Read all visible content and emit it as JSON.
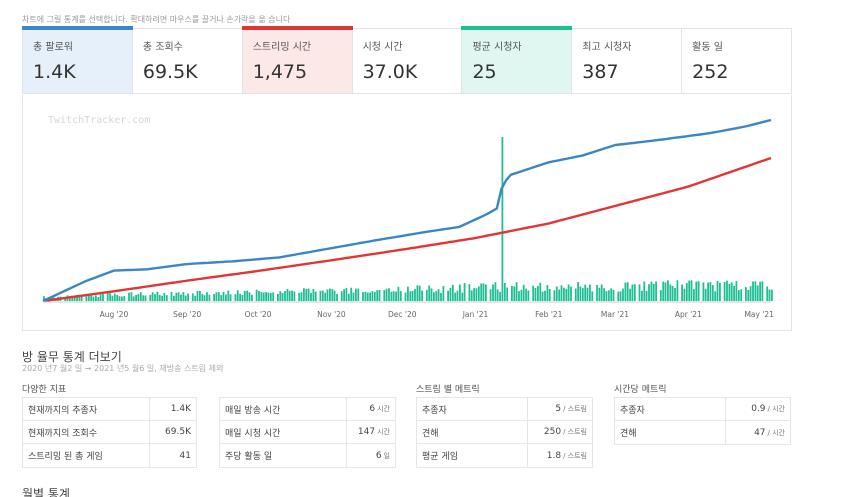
{
  "hint": "차트에 그릴 통계를 선택합니다. 확대하려면 마우스를 끌거나 손가락을 옮 습니다",
  "stats": [
    {
      "label": "총 팔로워",
      "value": "1.4K",
      "color": "blue"
    },
    {
      "label": "총 조회수",
      "value": "69.5K",
      "color": ""
    },
    {
      "label": "스트리밍 시간",
      "value": "1,475",
      "color": "red"
    },
    {
      "label": "시청 시간",
      "value": "37.0K",
      "color": ""
    },
    {
      "label": "평균 시청자",
      "value": "25",
      "color": "teal"
    },
    {
      "label": "최고 시청자",
      "value": "387",
      "color": ""
    },
    {
      "label": "활동 일",
      "value": "252",
      "color": ""
    }
  ],
  "chart": {
    "watermark": "TwitchTracker.com",
    "colors": {
      "followers": "#3b86c4",
      "hours": "#e23535",
      "viewers": "#1fbf93"
    }
  },
  "chart_data": {
    "type": "line",
    "x_ticks": [
      "Aug '20",
      "Sep '20",
      "Oct '20",
      "Nov '20",
      "Dec '20",
      "Jan '21",
      "Feb '21",
      "Mar '21",
      "Apr '21",
      "May '21"
    ],
    "x_range": [
      "2020-07-02",
      "2021-05-06"
    ],
    "series": [
      {
        "metric": "followers",
        "style": "line",
        "points": [
          [
            "2020-07-02",
            0
          ],
          [
            "2020-07-20",
            150
          ],
          [
            "2020-08-01",
            230
          ],
          [
            "2020-08-15",
            240
          ],
          [
            "2020-09-01",
            280
          ],
          [
            "2020-09-20",
            300
          ],
          [
            "2020-10-10",
            330
          ],
          [
            "2020-11-01",
            400
          ],
          [
            "2020-11-20",
            460
          ],
          [
            "2020-12-10",
            520
          ],
          [
            "2020-12-25",
            560
          ],
          [
            "2021-01-05",
            650
          ],
          [
            "2021-01-10",
            700
          ],
          [
            "2021-01-12",
            850
          ],
          [
            "2021-01-15",
            950
          ],
          [
            "2021-02-01",
            1050
          ],
          [
            "2021-02-15",
            1100
          ],
          [
            "2021-03-01",
            1180
          ],
          [
            "2021-03-20",
            1220
          ],
          [
            "2021-04-10",
            1270
          ],
          [
            "2021-04-25",
            1320
          ],
          [
            "2021-05-06",
            1370
          ]
        ]
      },
      {
        "metric": "hours",
        "style": "line",
        "points": [
          [
            "2020-07-02",
            0
          ],
          [
            "2020-08-01",
            100
          ],
          [
            "2020-09-01",
            210
          ],
          [
            "2020-10-01",
            310
          ],
          [
            "2020-11-01",
            420
          ],
          [
            "2020-12-01",
            530
          ],
          [
            "2021-01-01",
            650
          ],
          [
            "2021-02-01",
            800
          ],
          [
            "2021-03-01",
            980
          ],
          [
            "2021-04-01",
            1180
          ],
          [
            "2021-05-06",
            1475
          ]
        ]
      },
      {
        "metric": "viewers",
        "style": "bar",
        "peak": {
          "date": "2021-01-12",
          "value": 387
        },
        "ranges": [
          [
            "2020-07-02",
            6,
            12
          ],
          [
            "2020-08-01",
            10,
            20
          ],
          [
            "2020-09-01",
            12,
            24
          ],
          [
            "2020-10-01",
            14,
            28
          ],
          [
            "2020-11-01",
            16,
            32
          ],
          [
            "2020-12-01",
            18,
            35
          ],
          [
            "2021-01-01",
            20,
            45
          ],
          [
            "2021-02-01",
            22,
            45
          ],
          [
            "2021-03-01",
            22,
            48
          ],
          [
            "2021-04-01",
            22,
            50
          ],
          [
            "2021-05-06",
            24,
            50
          ]
        ]
      }
    ]
  },
  "more_stats": {
    "title": "방 율무 통계 더보기",
    "date_range": "2020 년7 월2 일 ➞ 2021 년5 월6 일, 재방송 스트림 제외",
    "groups": [
      {
        "title": "다양한 지표",
        "rows": [
          {
            "key": "현재까지의 추종자",
            "value": "1.4K",
            "unit": ""
          },
          {
            "key": "현재까지의 조회수",
            "value": "69.5K",
            "unit": ""
          },
          {
            "key": "스트리밍 된 총 게임",
            "value": "41",
            "unit": ""
          }
        ]
      },
      {
        "title": "",
        "rows": [
          {
            "key": "매일 방송 시간",
            "value": "6",
            "unit": "시간"
          },
          {
            "key": "매일 시청 시간",
            "value": "147",
            "unit": "시간"
          },
          {
            "key": "주당 활동 일",
            "value": "6",
            "unit": "일"
          }
        ]
      },
      {
        "title": "스트림 별 메트릭",
        "rows": [
          {
            "key": "추종자",
            "value": "5",
            "unit": "/ 스트림"
          },
          {
            "key": "견해",
            "value": "250",
            "unit": "/ 스트림"
          },
          {
            "key": "평균 게임",
            "value": "1.8",
            "unit": "/ 스트림"
          }
        ]
      },
      {
        "title": "시간당 메트릭",
        "rows": [
          {
            "key": "추종자",
            "value": "0.9",
            "unit": "/ 시간"
          },
          {
            "key": "견해",
            "value": "47",
            "unit": "/ 시간"
          }
        ]
      }
    ]
  },
  "monthly_title": "월별 통계"
}
